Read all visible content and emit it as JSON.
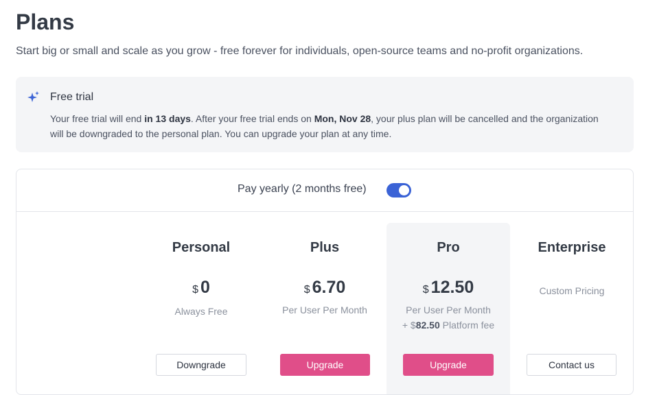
{
  "header": {
    "title": "Plans",
    "subtitle": "Start big or small and scale as you grow - free forever for individuals, open-source teams and no-profit organizations."
  },
  "trial": {
    "icon": "sparkle-icon",
    "title": "Free trial",
    "text_1": "Your free trial will end ",
    "days": "in 13 days",
    "text_2": ". After your free trial ends on ",
    "end_date": "Mon, Nov 28",
    "text_3": ", your plus plan will be cancelled and the organization will be downgraded to the personal plan. You can upgrade your plan at any time."
  },
  "billing": {
    "label": "Pay yearly (2 months free)",
    "yearly_enabled": true
  },
  "plans": [
    {
      "name": "Personal",
      "currency": "$",
      "price": "0",
      "subtitle": "Always Free",
      "button": "Downgrade"
    },
    {
      "name": "Plus",
      "currency": "$",
      "price": "6.70",
      "subtitle": "Per User Per Month",
      "button": "Upgrade"
    },
    {
      "name": "Pro",
      "currency": "$",
      "price": "12.50",
      "subtitle": "Per User Per Month",
      "fee_prefix": "+ $",
      "fee_amount": "82.50",
      "fee_suffix": " Platform fee",
      "button": "Upgrade"
    },
    {
      "name": "Enterprise",
      "pricing": "Custom Pricing",
      "button": "Contact us"
    }
  ],
  "colors": {
    "accent": "#3b63d6",
    "primary_button": "#e04e89",
    "panel_bg": "#f4f5f7"
  }
}
